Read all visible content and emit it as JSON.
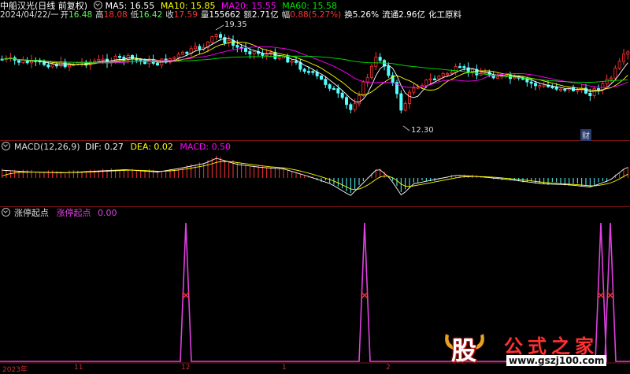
{
  "header": {
    "stock_name": "中船汉光(日线 前复权)",
    "ma5": "MA5: 16.55",
    "ma10": "MA10: 15.85",
    "ma20": "MA20: 15.55",
    "ma60": "MA60: 15.58",
    "date": "2024/04/22/一",
    "open_label": "开",
    "open": "16.48",
    "high_label": "高",
    "high": "18.08",
    "low_label": "低",
    "low": "16.42",
    "close_label": "收",
    "close": "17.59",
    "vol_label": "量",
    "vol": "155662",
    "amt_label": "额",
    "amt": "2.71亿",
    "chg_label": "幅",
    "chg": "0.88(5.27%)",
    "turnover": "换5.26%",
    "float_cap": "流通2.96亿",
    "industry": "化工原料"
  },
  "price_annotations": {
    "high_mark": "19.35",
    "low_mark": "12.30",
    "fin_badge": "财"
  },
  "macd_pane": {
    "title": "MACD(12,26,9)",
    "dif": "DIF: 0.27",
    "dea": "DEA: 0.02",
    "macd": "MACD: 0.50"
  },
  "signal_pane": {
    "title": "涨停起点",
    "series_label": "涨停起点",
    "value": "0.00",
    "marker": "K"
  },
  "x_axis": {
    "labels": [
      "2023年",
      "11",
      "12",
      "1",
      "2"
    ]
  },
  "watermark": {
    "logo_char": "股",
    "brand": "公式之家",
    "url": "www.gszj100.com"
  },
  "colors": {
    "background": "#000000",
    "up": "#ff3232",
    "down": "#54ffff",
    "ma5": "#ffffff",
    "ma10": "#ffff00",
    "ma20": "#ff00ff",
    "ma60": "#00e600",
    "signal": "#e040e0",
    "separator": "#7a1414"
  }
}
